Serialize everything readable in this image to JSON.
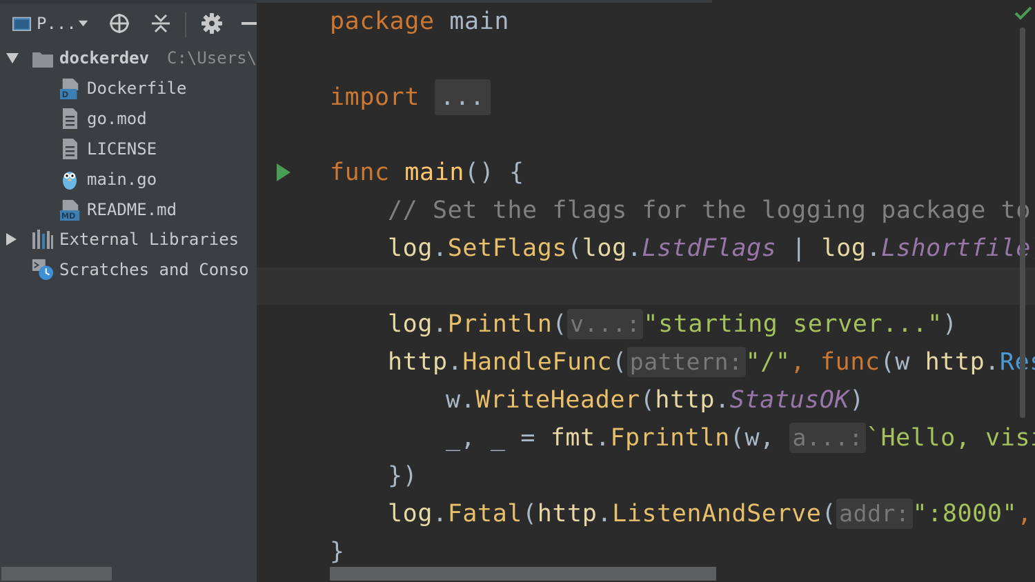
{
  "toolbar": {
    "project_view_label": "P...",
    "icons": [
      "project-view-icon",
      "dropdown-arrow-icon",
      "locate-icon",
      "collapse-all-icon",
      "gear-icon",
      "hide-icon"
    ]
  },
  "project_tree": {
    "root": {
      "name": "dockerdev",
      "path": "C:\\Users\\"
    },
    "files": [
      {
        "name": "Dockerfile",
        "icon": "dockerfile-icon"
      },
      {
        "name": "go.mod",
        "icon": "text-file-icon"
      },
      {
        "name": "LICENSE",
        "icon": "text-file-icon"
      },
      {
        "name": "main.go",
        "icon": "gopher-icon"
      },
      {
        "name": "README.md",
        "icon": "markdown-file-icon"
      }
    ],
    "external_libraries": "External Libraries",
    "scratches": "Scratches and Conso"
  },
  "editor": {
    "lines": {
      "package_kw": "package",
      "package_name": "main",
      "import_kw": "import",
      "import_fold": "...",
      "func_kw": "func",
      "func_name": "main",
      "func_sig_rest": "() {",
      "comment": "// Set the flags for the logging package to g",
      "setflags_pkg": "log",
      "setflags_meth": "SetFlags",
      "setflags_arg1_pkg": "log",
      "setflags_arg1": "LstdFlags",
      "setflags_pipe": " | ",
      "setflags_arg2_pkg": "log",
      "setflags_arg2": "Lshortfile",
      "println_pkg": "log",
      "println_meth": "Println",
      "println_hint": "v...:",
      "println_str": "\"starting server...\"",
      "hf_pkg": "http",
      "hf_meth": "HandleFunc",
      "hf_hint": "pattern:",
      "hf_str": "\"/\"",
      "hf_func_kw": "func",
      "hf_param": "w",
      "hf_type_pkg": "http",
      "hf_type": "Res",
      "wh_recv": "w",
      "wh_meth": "WriteHeader",
      "wh_pkg": "http",
      "wh_const": "StatusOK",
      "fp_lhs": "_, _ = ",
      "fp_pkg": "fmt",
      "fp_meth": "Fprintln",
      "fp_arg": "w, ",
      "fp_hint": "a...:",
      "fp_str": "`Hello, visi",
      "close_paren": "})",
      "fatal_pkg": "log",
      "fatal_meth": "Fatal",
      "fatal_arg_pkg": "http",
      "fatal_arg_meth": "ListenAndServe",
      "fatal_hint": "addr:",
      "fatal_str": "\":8000\"",
      "close_brace": "}"
    }
  },
  "colors": {
    "keyword": "#cc7832",
    "function": "#ffc66d",
    "identifier": "#a9b7c6",
    "comment": "#808080",
    "constant": "#9876aa",
    "string": "#6a8759",
    "run_gutter": "#499c54",
    "check": "#499c54"
  }
}
